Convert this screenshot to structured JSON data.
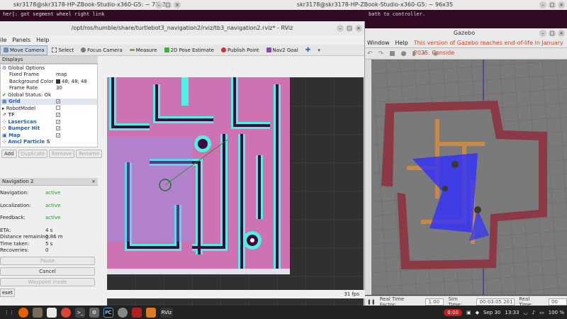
{
  "terminals": {
    "left_title": "skr3178@skr3178-HP-ZBook-Studio-x360-G5: ~ 75x35",
    "left_line": "her]: got segment wheel right link",
    "right_title": "skr3178@skr3178-HP-ZBook-Studio-x360-G5: ~ 96x35",
    "right_line": "bath to controller."
  },
  "rviz": {
    "title": "/opt/ros/humble/share/turtlebot3_navigation2/rviz/tb3_navigation2.rviz* - RViz",
    "menu": [
      "ile",
      "Panels",
      "Help"
    ],
    "tools": [
      "Move Camera",
      "Select",
      "Focus Camera",
      "Measure",
      "2D Pose Estimate",
      "Publish Point",
      "Nav2 Goal"
    ],
    "displays_header": "Displays",
    "global_options": "Global Options",
    "fixed_frame_label": "Fixed Frame",
    "fixed_frame_value": "map",
    "bg_color_label": "Background Color",
    "bg_color_value": "48; 48; 48",
    "frame_rate_label": "Frame Rate",
    "frame_rate_value": "30",
    "global_status": "Global Status: Ok",
    "display_items": [
      "Grid",
      "RobotModel",
      "TF",
      "LaserScan",
      "Bumper Hit",
      "Map",
      "Amcl Particle S"
    ],
    "display_buttons": [
      "Add",
      "Duplicate",
      "Remove",
      "Rename"
    ],
    "nav_header": "Navigation 2",
    "navigation_label": "Navigation:",
    "navigation_value": "active",
    "localization_label": "Localization:",
    "localization_value": "active",
    "feedback_label": "Feedback:",
    "feedback_value": "active",
    "eta_label": "ETA:",
    "eta_value": "4 s",
    "distance_label": "Distance remaining:",
    "distance_value": "0.86 m",
    "time_label": "Time taken:",
    "time_value": "5 s",
    "recoveries_label": "Recoveries:",
    "recoveries_value": "0",
    "pause_label": "Pause",
    "cancel_label": "Cancel",
    "waypoint_label": "Waypoint mode",
    "reset_label": "eset",
    "fps": "31 fps"
  },
  "gazebo": {
    "title": "Gazebo",
    "menu": [
      "Window",
      "Help"
    ],
    "warning": "This version of Gazebo reaches end-of-life in January 2025. Conside",
    "real_time_label": "Real Time Factor:",
    "real_time_value": "1.00",
    "sim_time_label": "Sim Time:",
    "sim_time_value": "00:03:05.201",
    "real_time2_label": "Real Time:",
    "real_time2_value": "00"
  },
  "tray": {
    "recording": "0:00",
    "date": "Sep 30",
    "time": "13:33",
    "battery": "100 %"
  },
  "colors": {
    "map_magenta": "#c65aa5",
    "map_cyan": "#4ff0e8",
    "map_dark": "#3d0a3a",
    "gazebo_wall": "#8b3a45",
    "gazebo_floor": "#c58a45",
    "laser_blue": "#3030ff"
  }
}
